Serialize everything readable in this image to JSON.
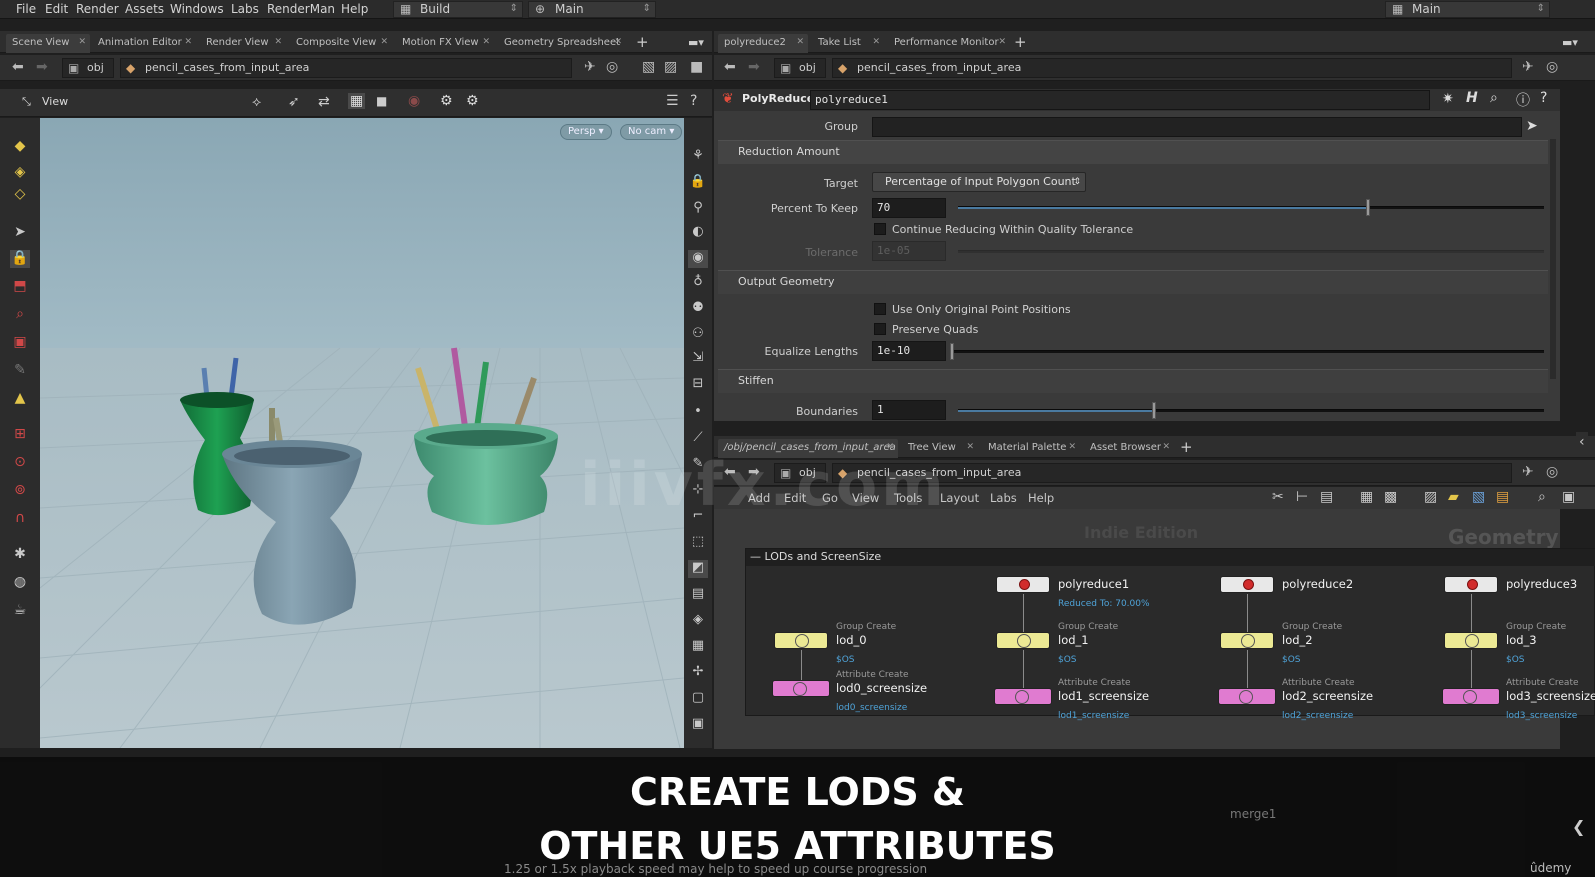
{
  "menu": [
    "File",
    "Edit",
    "Render",
    "Assets",
    "Windows",
    "Labs",
    "RenderMan",
    "Help"
  ],
  "desktop_select": "Build",
  "context_select": "Main",
  "right_context_select": "Main",
  "left_tabs": [
    "Scene View",
    "Animation Editor",
    "Render View",
    "Composite View",
    "Motion FX View",
    "Geometry Spreadsheet"
  ],
  "right_tabs": [
    "polyreduce2",
    "Take List",
    "Performance Monitor"
  ],
  "net_tabs": [
    "/obj/pencil_cases_from_input_area",
    "Tree View",
    "Material Palette",
    "Asset Browser"
  ],
  "path_obj": "obj",
  "path_node": "pencil_cases_from_input_area",
  "viewer_label": "View",
  "persp_label": "Persp",
  "cam_label": "No cam",
  "param": {
    "node_type": "PolyReduce",
    "node_name": "polyreduce1",
    "group_label": "Group",
    "section_reduction": "Reduction Amount",
    "target_label": "Target",
    "target_value": "Percentage of Input Polygon Count",
    "percent_label": "Percent To Keep",
    "percent_value": "70",
    "percent_fraction": 0.7,
    "continue_label": "Continue Reducing Within Quality Tolerance",
    "tolerance_label": "Tolerance",
    "tolerance_value": "1e-05",
    "section_output": "Output Geometry",
    "orig_points_label": "Use Only Original Point Positions",
    "preserve_quads_label": "Preserve Quads",
    "equalize_label": "Equalize Lengths",
    "equalize_value": "1e-10",
    "section_stiffen": "Stiffen",
    "boundaries_label": "Boundaries",
    "boundaries_value": "1"
  },
  "net_menu": [
    "Add",
    "Edit",
    "Go",
    "View",
    "Tools",
    "Layout",
    "Labs",
    "Help"
  ],
  "net_box_title": "LODs and ScreenSize",
  "net_watermark_1": "Indie Edition",
  "net_watermark_2": "Geometry",
  "nodes": {
    "poly1": {
      "name": "polyreduce1",
      "comment": "Reduced To: 70.00%"
    },
    "poly2": {
      "name": "polyreduce2"
    },
    "poly3": {
      "name": "polyreduce3"
    },
    "grp_type": "Group Create",
    "attr_type": "Attribute Create",
    "grp_comment": "$OS",
    "lod0": {
      "name": "lod_0",
      "attr": "lod0_screensize"
    },
    "lod1": {
      "name": "lod_1",
      "attr": "lod1_screensize"
    },
    "lod2": {
      "name": "lod_2",
      "attr": "lod2_screensize"
    },
    "lod3": {
      "name": "lod_3",
      "attr": "lod3_screensize"
    },
    "merge": "merge1"
  },
  "caption_line1": "CREATE LODS &",
  "caption_line2": "OTHER UE5 ATTRIBUTES",
  "footer_hint": "1.25 or 1.5x playback speed may help to speed up course progression",
  "brand": "ûdemy",
  "watermark": "iiivfx.com"
}
